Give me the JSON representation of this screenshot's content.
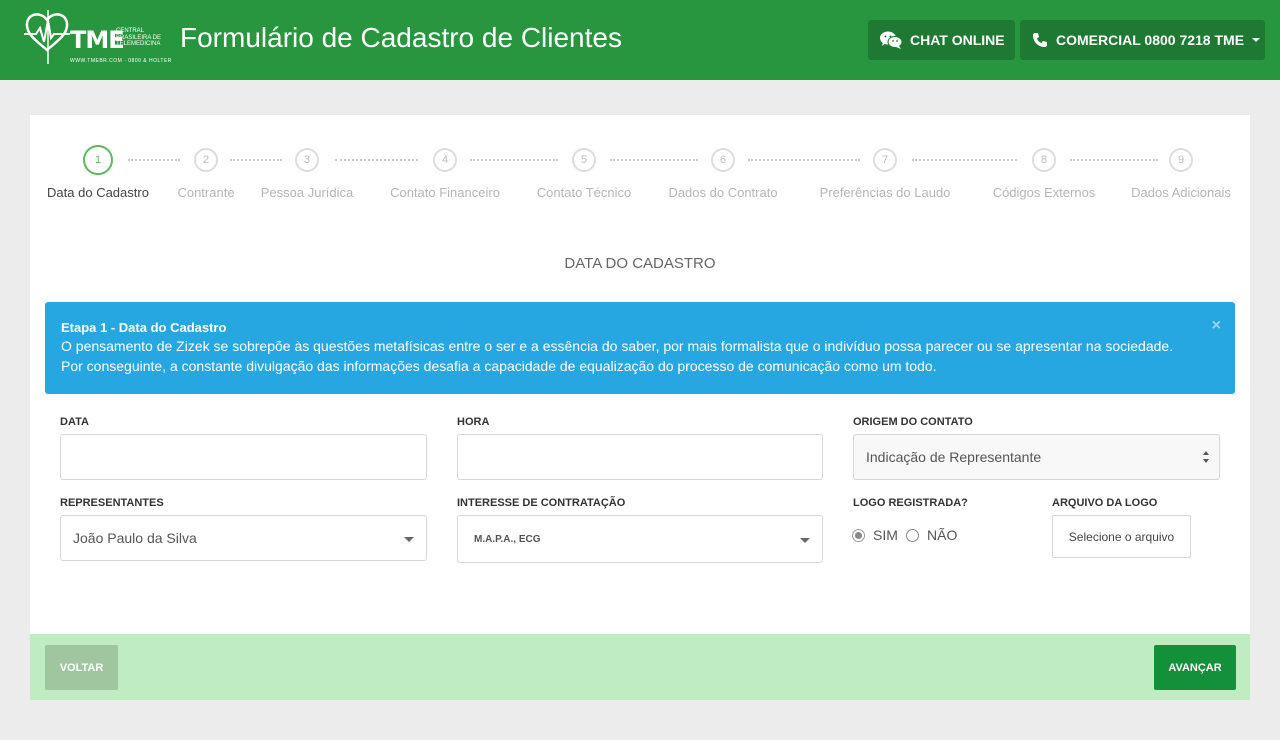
{
  "header": {
    "logo": {
      "brand": "TME",
      "subtitle": "Central Brasileira de Telemedicina",
      "url": "WWW.TMEBR.COM · 0800 & HOLTER"
    },
    "title": "Formulário de Cadastro de Clientes",
    "chat_label": "CHAT ONLINE",
    "comercial_label": "COMERCIAL 0800 7218 TME",
    "chat_icon": "wechat-icon",
    "phone_icon": "phone-icon"
  },
  "wizard": {
    "steps": [
      {
        "number": "1",
        "label": "Data do Cadastro",
        "active": true
      },
      {
        "number": "2",
        "label": "Contrante",
        "active": false
      },
      {
        "number": "3",
        "label": "Pessoa Jurídica",
        "active": false
      },
      {
        "number": "4",
        "label": "Contato Financeiro",
        "active": false
      },
      {
        "number": "5",
        "label": "Contato Técnico",
        "active": false
      },
      {
        "number": "6",
        "label": "Dados do Contrato",
        "active": false
      },
      {
        "number": "7",
        "label": "Preferências do Laudo",
        "active": false
      },
      {
        "number": "8",
        "label": "Códigos Externos",
        "active": false
      },
      {
        "number": "9",
        "label": "Dados Adicionais",
        "active": false
      }
    ]
  },
  "section_title": "DATA DO CADASTRO",
  "alert": {
    "title": "Etapa 1 - Data do Cadastro",
    "body": "O pensamento de Zizek se sobrepõe às questões metafísicas entre o ser e a essência do saber, por mais formalista que o indivíduo possa parecer ou se apresentar na sociedade. Por conseguinte, a constante divulgação das informações desafia a capacidade de equalização do processo de comunicação como um todo.",
    "close": "×"
  },
  "form": {
    "data_label": "DATA",
    "data_value": "",
    "hora_label": "HORA",
    "hora_value": "",
    "origem_label": "ORIGEM DO CONTATO",
    "origem_value": "Indicação de Representante",
    "representantes_label": "REPRESENTANTES",
    "representantes_value": "João Paulo da Silva",
    "interesse_label": "INTERESSE DE CONTRATAÇÃO",
    "interesse_value": "M.A.P.A., ECG",
    "logo_label": "LOGO REGISTRADA?",
    "logo_options": [
      {
        "label": "SIM",
        "checked": true
      },
      {
        "label": "NÃO",
        "checked": false
      }
    ],
    "arquivo_label": "ARQUIVO DA LOGO",
    "arquivo_button": "Selecione o arquivo"
  },
  "footer": {
    "back_label": "VOLTAR",
    "next_label": "AVANÇAR"
  },
  "colors": {
    "header_bg": "#27963e",
    "alert_bg": "#27a7e1",
    "active_step": "#5cb85c",
    "footer_bg": "#c0ecc1",
    "next_button": "#14903a"
  }
}
